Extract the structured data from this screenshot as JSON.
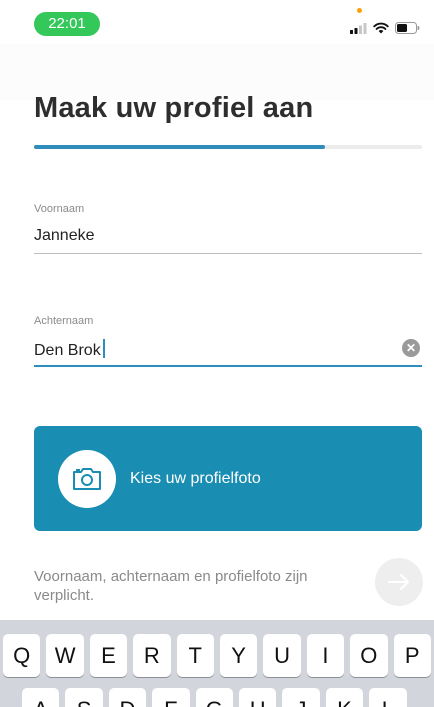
{
  "status_bar": {
    "time": "22:01"
  },
  "page": {
    "title": "Maak uw profiel aan",
    "progress": 0.75
  },
  "first_name": {
    "label": "Voornaam",
    "value": "Janneke"
  },
  "last_name": {
    "label": "Achternaam",
    "value": "Den Brok"
  },
  "photo_button": {
    "label": "Kies uw profielfoto"
  },
  "hint": {
    "text": "Voornaam, achternaam en profielfoto zijn verplicht."
  },
  "keyboard": {
    "row1": [
      "Q",
      "W",
      "E",
      "R",
      "T",
      "Y",
      "U",
      "I",
      "O",
      "P"
    ],
    "row2": [
      "A",
      "S",
      "D",
      "F",
      "G",
      "H",
      "J",
      "K",
      "L"
    ]
  },
  "colors": {
    "accent": "#1a8db2",
    "progress": "#2f8dbb",
    "time_pill": "#34c759"
  }
}
